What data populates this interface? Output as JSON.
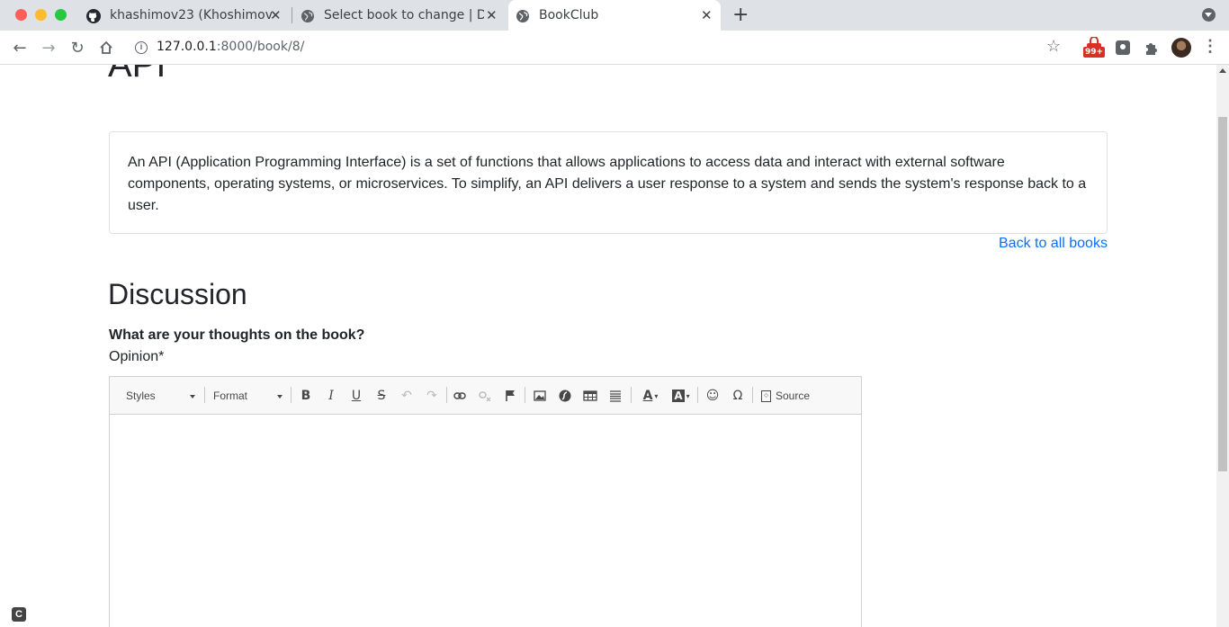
{
  "browser": {
    "tabs": [
      {
        "title": "khashimov23 (Khoshimov",
        "icon": "github-icon"
      },
      {
        "title": "Select book to change | Dj",
        "icon": "globe-icon"
      },
      {
        "title": "BookClub",
        "icon": "globe-icon",
        "active": true
      }
    ],
    "url_host": "127.0.0.1",
    "url_rest": ":8000/book/8/",
    "extension_badge": "99+"
  },
  "book": {
    "title": "API",
    "description": "An API (Application Programming Interface) is a set of functions that allows applications to access data and interact with external software components, operating systems, or microservices. To simplify, an API delivers a user response to a system and sends the system's response back to a user.",
    "back_link": "Back to all books"
  },
  "discussion": {
    "heading": "Discussion",
    "prompt": "What are your thoughts on the book?",
    "field_label": "Opinion*"
  },
  "editor": {
    "styles_label": "Styles",
    "format_label": "Format",
    "source_label": "Source"
  },
  "corner_badge": "C"
}
